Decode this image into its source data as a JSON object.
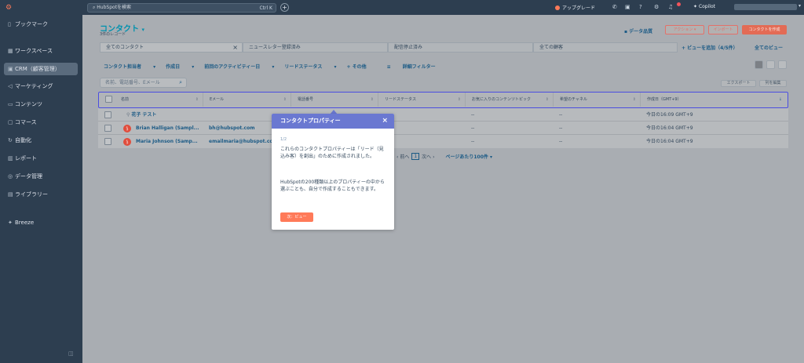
{
  "sidebar": {
    "items": [
      {
        "icon": "bookmark-icon",
        "label": "ブックマーク"
      },
      {
        "icon": "grid-icon",
        "label": "ワークスペース"
      },
      {
        "icon": "contacts-icon",
        "label": "CRM（顧客管理）"
      },
      {
        "icon": "megaphone-icon",
        "label": "マーケティング"
      },
      {
        "icon": "document-icon",
        "label": "コンテンツ"
      },
      {
        "icon": "cart-icon",
        "label": "コマース"
      },
      {
        "icon": "automation-icon",
        "label": "自動化"
      },
      {
        "icon": "chart-icon",
        "label": "レポート"
      },
      {
        "icon": "database-icon",
        "label": "データ管理"
      },
      {
        "icon": "library-icon",
        "label": "ライブラリー"
      },
      {
        "icon": "sparkle-icon",
        "label": "Breeze"
      }
    ]
  },
  "topbar": {
    "search_placeholder": "HubSpotを検索",
    "shortcut": "Ctrl K",
    "upgrade": "アップグレード",
    "copilot": "Copilot"
  },
  "page": {
    "title": "コンタクト",
    "record_count": "3件のレコード",
    "data_quality": "データ品質",
    "actions_button": "アクション",
    "import_button": "インポート",
    "create_button": "コンタクトを作成"
  },
  "tabs": [
    {
      "label": "全てのコンタクト",
      "active": true
    },
    {
      "label": "ニュースレター登録済み"
    },
    {
      "label": "配信停止済み"
    },
    {
      "label": "全ての顧客"
    }
  ],
  "views": {
    "add": "ビューを追加（4/5件）",
    "all": "全てのビュー"
  },
  "filters": [
    "コンタクト担当者",
    "作成日",
    "前回のアクティビティー日",
    "リードステータス",
    "その他",
    "詳細フィルター"
  ],
  "table_search_placeholder": "名前、電話番号、Eメール",
  "toolbar": {
    "export": "エクスポート",
    "edit_columns": "列を編集"
  },
  "table": {
    "headers": [
      "名前",
      "Eメール",
      "電話番号",
      "リードステータス",
      "お気に入りのコンテンツトピック",
      "希望のチャネル",
      "作成日（GMT+9）"
    ],
    "rows": [
      {
        "name": "花子 テスト",
        "email": "",
        "phone": "",
        "status": "",
        "topic": "--",
        "channel": "--",
        "created": "今日の16:09 GMT+9"
      },
      {
        "name": "Brian Halligan (Sampl...",
        "email": "bh@hubspot.com",
        "phone": "",
        "status": "",
        "topic": "--",
        "channel": "--",
        "created": "今日の16:04 GMT+9"
      },
      {
        "name": "Maria Johnson (Samp...",
        "email": "emailmaria@hubspot.co",
        "phone": "",
        "status": "",
        "topic": "--",
        "channel": "--",
        "created": "今日の16:04 GMT+9"
      }
    ]
  },
  "pagination": {
    "prev": "前へ",
    "page": "1",
    "next": "次へ",
    "per_page": "ページあたり100件"
  },
  "popup": {
    "title": "コンタクトプロパティー",
    "step": "1/2",
    "text1": "これらのコンタクトプロパティーは「リード（見込み客）を創出」のために作成されました。",
    "text2": "HubSpotの200種類以上のプロパティーの中から選ぶことも、自分で作成することもできます。",
    "next_button": "次：ビュー"
  },
  "colors": {
    "accent": "#0091ae",
    "popup_header": "#6a78d1",
    "primary_button": "#ff7a59",
    "sidebar": "#2d3e50"
  }
}
